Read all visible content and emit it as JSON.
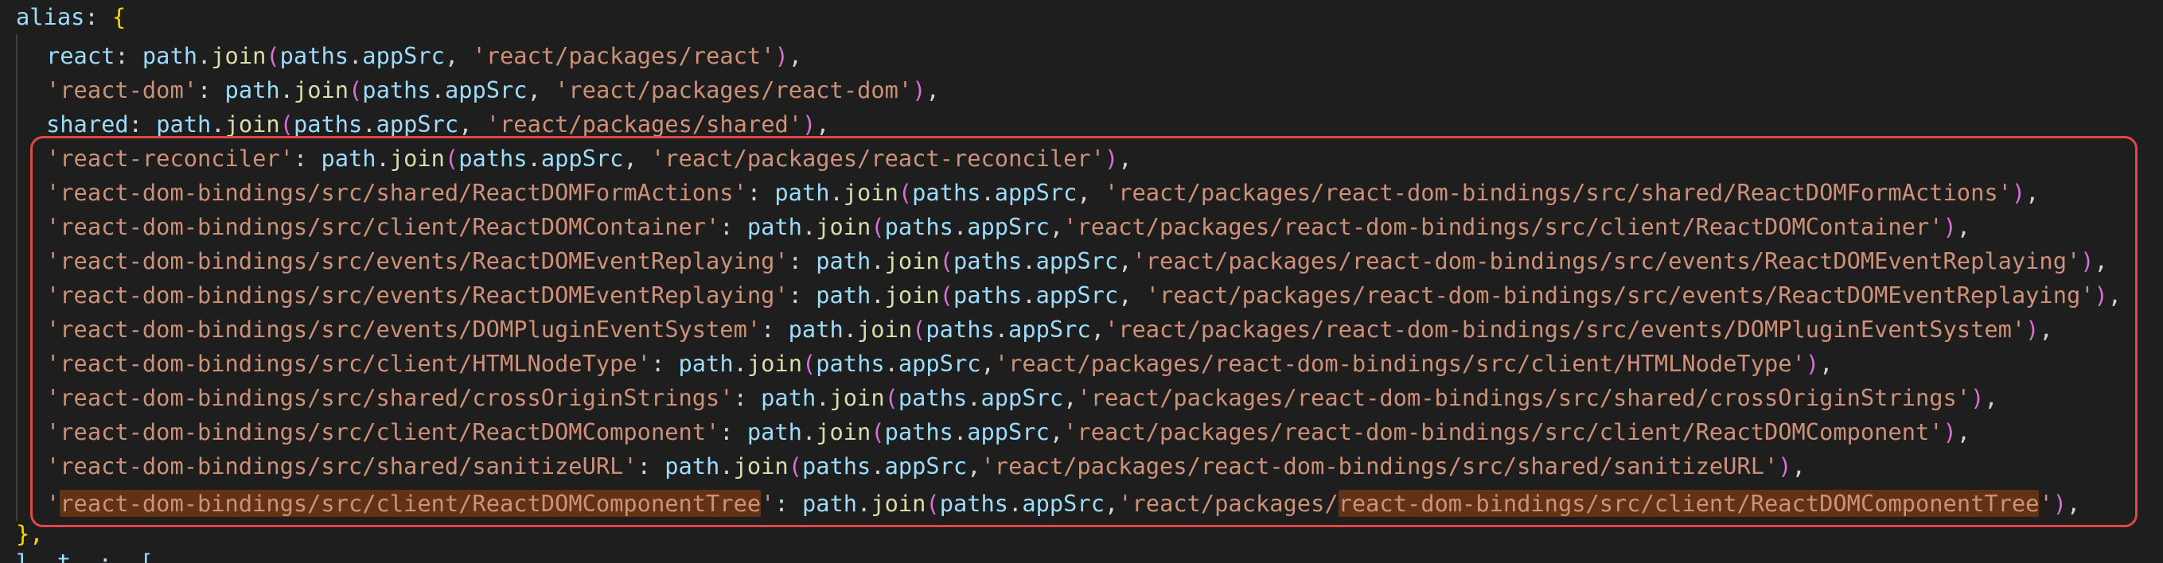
{
  "editor": {
    "alias_line": {
      "key": "alias",
      "colon": ": ",
      "open_brace": "{"
    },
    "entries": [
      {
        "key": "react",
        "method_object": "path",
        "dot": ".",
        "method": "join",
        "open": "(",
        "base_object": "paths",
        "base_prop": "appSrc",
        "comma": ", ",
        "value": "'react/packages/react'",
        "close": ")",
        "trail": ","
      },
      {
        "key": "'react-dom'",
        "method_object": "path",
        "dot": ".",
        "method": "join",
        "open": "(",
        "base_object": "paths",
        "base_prop": "appSrc",
        "comma": ", ",
        "value": "'react/packages/react-dom'",
        "close": ")",
        "trail": ","
      },
      {
        "key": "shared",
        "method_object": "path",
        "dot": ".",
        "method": "join",
        "open": "(",
        "base_object": "paths",
        "base_prop": "appSrc",
        "comma": ", ",
        "value": "'react/packages/shared'",
        "close": ")",
        "trail": ","
      },
      {
        "key": "'react-reconciler'",
        "method_object": "path",
        "dot": ".",
        "method": "join",
        "open": "(",
        "base_object": "paths",
        "base_prop": "appSrc",
        "comma": ", ",
        "value": "'react/packages/react-reconciler'",
        "close": ")",
        "trail": ","
      },
      {
        "key": "'react-dom-bindings/src/shared/ReactDOMFormActions'",
        "method_object": "path",
        "dot": ".",
        "method": "join",
        "open": "(",
        "base_object": "paths",
        "base_prop": "appSrc",
        "comma": ", ",
        "value": "'react/packages/react-dom-bindings/src/shared/ReactDOMFormActions'",
        "close": ")",
        "trail": ","
      },
      {
        "key": "'react-dom-bindings/src/client/ReactDOMContainer'",
        "method_object": "path",
        "dot": ".",
        "method": "join",
        "open": "(",
        "base_object": "paths",
        "base_prop": "appSrc",
        "comma": ",",
        "value": "'react/packages/react-dom-bindings/src/client/ReactDOMContainer'",
        "close": ")",
        "trail": ","
      },
      {
        "key": "'react-dom-bindings/src/events/ReactDOMEventReplaying'",
        "method_object": "path",
        "dot": ".",
        "method": "join",
        "open": "(",
        "base_object": "paths",
        "base_prop": "appSrc",
        "comma": ",",
        "value": "'react/packages/react-dom-bindings/src/events/ReactDOMEventReplaying'",
        "close": ")",
        "trail": ","
      },
      {
        "key": "'react-dom-bindings/src/events/ReactDOMEventReplaying'",
        "method_object": "path",
        "dot": ".",
        "method": "join",
        "open": "(",
        "base_object": "paths",
        "base_prop": "appSrc",
        "comma": ", ",
        "value": "'react/packages/react-dom-bindings/src/events/ReactDOMEventReplaying'",
        "close": ")",
        "trail": ","
      },
      {
        "key": "'react-dom-bindings/src/events/DOMPluginEventSystem'",
        "method_object": "path",
        "dot": ".",
        "method": "join",
        "open": "(",
        "base_object": "paths",
        "base_prop": "appSrc",
        "comma": ",",
        "value": "'react/packages/react-dom-bindings/src/events/DOMPluginEventSystem'",
        "close": ")",
        "trail": ","
      },
      {
        "key": "'react-dom-bindings/src/client/HTMLNodeType'",
        "method_object": "path",
        "dot": ".",
        "method": "join",
        "open": "(",
        "base_object": "paths",
        "base_prop": "appSrc",
        "comma": ",",
        "value": "'react/packages/react-dom-bindings/src/client/HTMLNodeType'",
        "close": ")",
        "trail": ","
      },
      {
        "key": "'react-dom-bindings/src/shared/crossOriginStrings'",
        "method_object": "path",
        "dot": ".",
        "method": "join",
        "open": "(",
        "base_object": "paths",
        "base_prop": "appSrc",
        "comma": ",",
        "value": "'react/packages/react-dom-bindings/src/shared/crossOriginStrings'",
        "close": ")",
        "trail": ","
      },
      {
        "key": "'react-dom-bindings/src/client/ReactDOMComponent'",
        "method_object": "path",
        "dot": ".",
        "method": "join",
        "open": "(",
        "base_object": "paths",
        "base_prop": "appSrc",
        "comma": ",",
        "value": "'react/packages/react-dom-bindings/src/client/ReactDOMComponent'",
        "close": ")",
        "trail": ","
      },
      {
        "key": "'react-dom-bindings/src/shared/sanitizeURL'",
        "method_object": "path",
        "dot": ".",
        "method": "join",
        "open": "(",
        "base_object": "paths",
        "base_prop": "appSrc",
        "comma": ",",
        "value": "'react/packages/react-dom-bindings/src/shared/sanitizeURL'",
        "close": ")",
        "trail": ","
      }
    ],
    "last_entry": {
      "quote_open": "'",
      "key_match": "react-dom-bindings/src/client/ReactDOMComponentTree",
      "quote_close": "'",
      "colon": ": ",
      "method_object": "path",
      "dot": ".",
      "method": "join",
      "open": "(",
      "base_object": "paths",
      "base_prop": "appSrc",
      "comma": ",",
      "value_prefix": "'react/packages/",
      "value_match": "react-dom-bindings/src/client/ReactDOMComponentTree",
      "value_suffix": "'",
      "close": ")",
      "trail": ","
    },
    "closing_line": "},",
    "partial_line": {
      "fragment": "l  t  :  [",
      "open": "["
    },
    "colors": {
      "background": "#1e1e1e",
      "property": "#9cdcfe",
      "string": "#ce9178",
      "function": "#dcdcaa",
      "bracket_level1": "#ffd700",
      "bracket_level2": "#da70d6",
      "bracket_level3": "#179fff",
      "annotation_box": "#e04848",
      "find_match": "#613214"
    }
  }
}
